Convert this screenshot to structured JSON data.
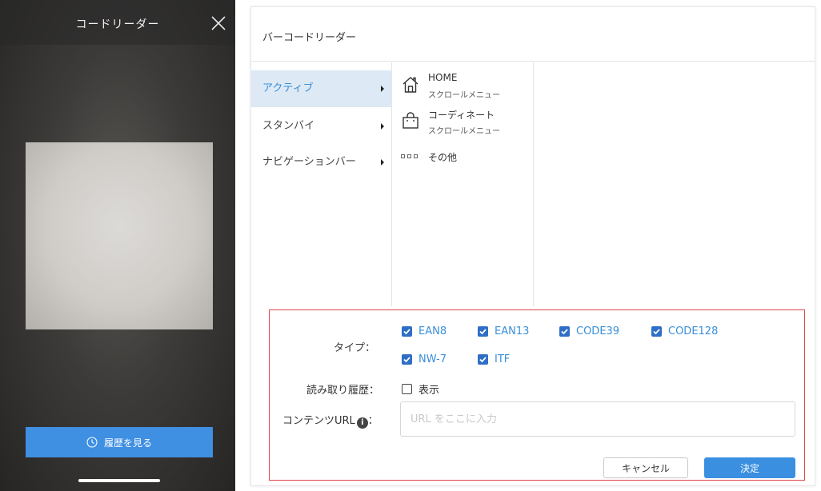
{
  "phone": {
    "title": "コードリーダー",
    "history_button_label": "履歴を見る"
  },
  "dialog": {
    "title": "バーコードリーダー",
    "menu": [
      {
        "label": "アクティブ",
        "active": true
      },
      {
        "label": "スタンバイ",
        "active": false
      },
      {
        "label": "ナビゲーションバー",
        "active": false
      }
    ],
    "submenu": [
      {
        "title": "HOME",
        "desc": "スクロールメニュー",
        "icon": "home-icon"
      },
      {
        "title": "コーディネート",
        "desc": "スクロールメニュー",
        "icon": "shopping-bag-icon"
      }
    ],
    "other_label": "その他"
  },
  "settings": {
    "type_label": "タイプ：",
    "types": [
      {
        "label": "EAN8",
        "checked": true
      },
      {
        "label": "EAN13",
        "checked": true
      },
      {
        "label": "CODE39",
        "checked": true
      },
      {
        "label": "CODE128",
        "checked": true
      },
      {
        "label": "NW-7",
        "checked": true
      },
      {
        "label": "ITF",
        "checked": true
      }
    ],
    "history_label": "読み取り履歴：",
    "history_option": {
      "label": "表示",
      "checked": false
    },
    "url_label": "コンテンツURL",
    "url_suffix": "：",
    "info_glyph": "i",
    "url_placeholder": "URL をここに入力",
    "url_value": "",
    "cancel_label": "キャンセル",
    "ok_label": "決定"
  },
  "colors": {
    "accent": "#3a8fe0",
    "active_bg": "#dde9f4",
    "highlight_border": "#e0454b",
    "checkbox": "#2f6ec7"
  }
}
